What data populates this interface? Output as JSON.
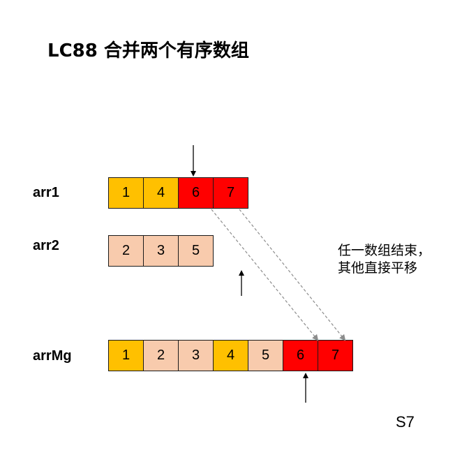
{
  "title": "LC88 合并两个有序数组",
  "arrays": {
    "arr1": {
      "label": "arr1",
      "values": [
        "1",
        "4",
        "6",
        "7"
      ],
      "colors": [
        "#FFC000",
        "#FFC000",
        "#FF0000",
        "#FF0000"
      ]
    },
    "arr2": {
      "label": "arr2",
      "values": [
        "2",
        "3",
        "5"
      ],
      "colors": [
        "#F8CBAD",
        "#F8CBAD",
        "#F8CBAD"
      ]
    },
    "arrMg": {
      "label": "arrMg",
      "values": [
        "1",
        "2",
        "3",
        "4",
        "5",
        "6",
        "7"
      ],
      "colors": [
        "#FFC000",
        "#F8CBAD",
        "#F8CBAD",
        "#FFC000",
        "#F8CBAD",
        "#FF0000",
        "#FF0000"
      ]
    }
  },
  "note": {
    "line1": "任一数组结束，",
    "line2": "其他直接平移"
  },
  "step": "S7"
}
